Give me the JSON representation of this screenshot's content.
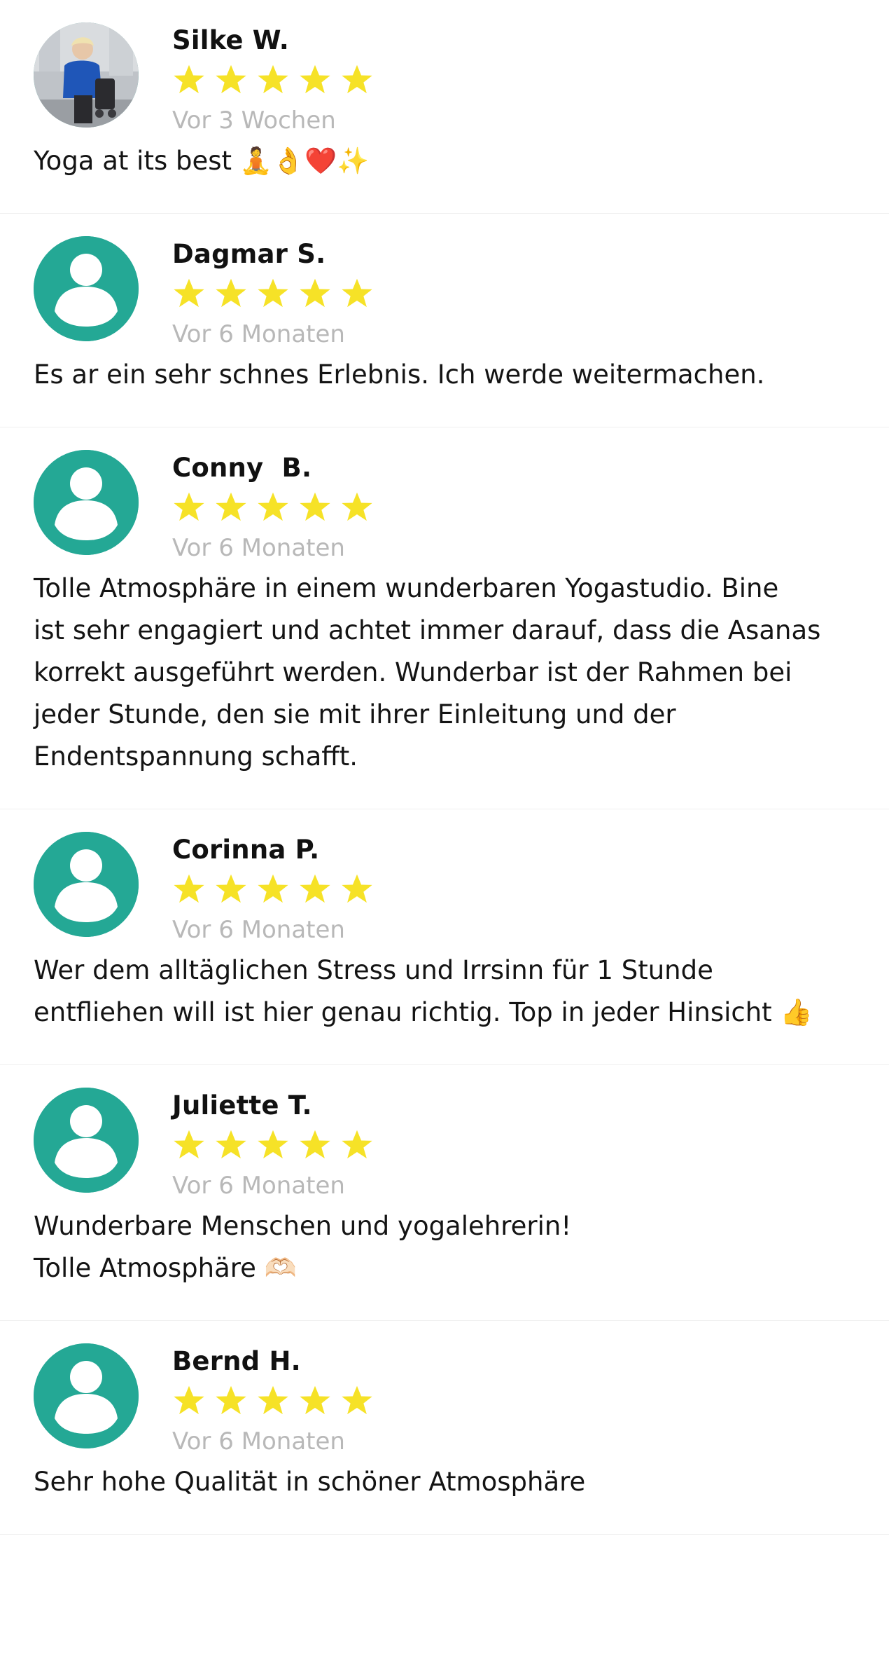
{
  "colors": {
    "avatar_bg": "#24a895",
    "star": "#f6e227",
    "date_text": "#b8b8b8",
    "divider": "#efefef"
  },
  "icons": {
    "avatar_placeholder": "user-silhouette-icon",
    "avatar_photo": "user-photo-avatar",
    "rating": "star-icon"
  },
  "reviews": [
    {
      "name": "Silke W.",
      "rating": 5,
      "max_rating": 5,
      "date": "Vor 3 Wochen",
      "text": "Yoga at its best 🧘👌❤️✨",
      "avatar": "photo"
    },
    {
      "name": "Dagmar S.",
      "rating": 5,
      "max_rating": 5,
      "date": "Vor 6 Monaten",
      "text": "Es ar ein sehr schnes Erlebnis.  Ich werde weitermachen.",
      "avatar": "placeholder"
    },
    {
      "name": "Conny  B.",
      "rating": 5,
      "max_rating": 5,
      "date": "Vor 6 Monaten",
      "text": "Tolle Atmosphäre in einem wunderbaren Yogastudio. Bine\nist sehr engagiert und achtet immer darauf, dass die Asanas\nkorrekt ausgeführt werden. Wunderbar ist der Rahmen bei\njeder Stunde, den sie mit ihrer Einleitung und der\nEndentspannung schafft.",
      "avatar": "placeholder"
    },
    {
      "name": "Corinna P.",
      "rating": 5,
      "max_rating": 5,
      "date": "Vor 6 Monaten",
      "text": "Wer dem alltäglichen Stress und Irrsinn  für 1 Stunde\nentfliehen will ist hier genau richtig.  Top in jeder Hinsicht 👍",
      "avatar": "placeholder"
    },
    {
      "name": "Juliette T.",
      "rating": 5,
      "max_rating": 5,
      "date": "Vor 6 Monaten",
      "text": "Wunderbare Menschen und yogalehrerin!\nTolle Atmosphäre 🫶🏻",
      "avatar": "placeholder"
    },
    {
      "name": "Bernd H.",
      "rating": 5,
      "max_rating": 5,
      "date": "Vor 6 Monaten",
      "text": "Sehr hohe Qualität in schöner Atmosphäre",
      "avatar": "placeholder"
    }
  ]
}
